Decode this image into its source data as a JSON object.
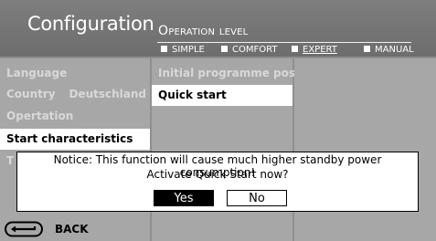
{
  "header": {
    "title": "Configuration",
    "level_title": "Operation level",
    "levels": [
      {
        "label": "SIMPLE",
        "active": false
      },
      {
        "label": "COMFORT",
        "active": false
      },
      {
        "label": "EXPERT",
        "active": true
      },
      {
        "label": "MANUAL",
        "active": false
      }
    ]
  },
  "menu": {
    "items": [
      {
        "label": "Language",
        "value": ""
      },
      {
        "label": "Country",
        "value": "Deutschland"
      },
      {
        "label": "Opertation",
        "value": ""
      },
      {
        "label": "Start characteristics",
        "value": "",
        "selected": true
      },
      {
        "label": "T",
        "value": ""
      }
    ]
  },
  "submenu": {
    "items": [
      {
        "label": "Initial programme positi-"
      },
      {
        "label": "Quick start",
        "selected": true
      }
    ]
  },
  "dialog": {
    "message_line1": "Notice: This function will cause much higher standby power consumption!",
    "message_line2": "Activate Quick Start now?",
    "yes_label": "Yes",
    "no_label": "No"
  },
  "footer": {
    "back_label": "BACK"
  },
  "colors": {
    "header_bg": "#757575",
    "panel_bg": "#a7a7a7",
    "selection_bg": "#ffffff",
    "text_dim": "#d8d8d8"
  }
}
